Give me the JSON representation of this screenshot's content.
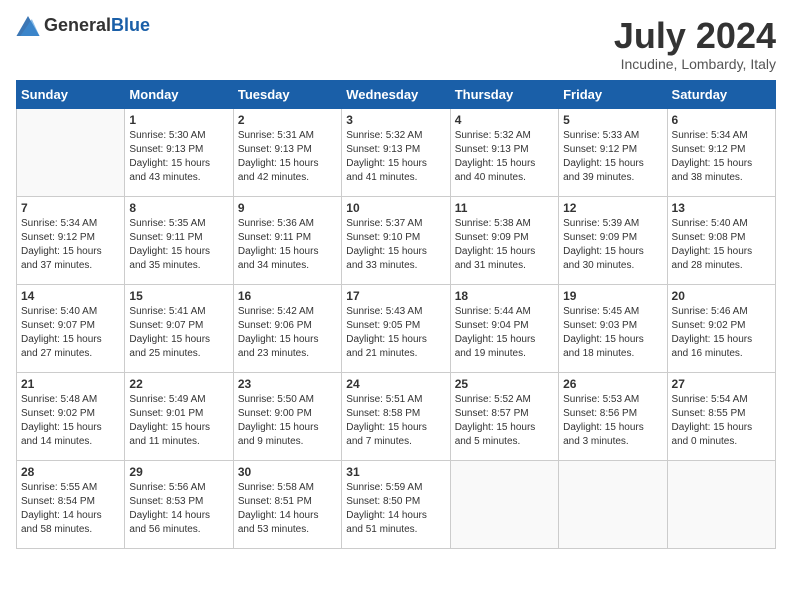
{
  "header": {
    "logo_general": "General",
    "logo_blue": "Blue",
    "title": "July 2024",
    "location": "Incudine, Lombardy, Italy"
  },
  "days_of_week": [
    "Sunday",
    "Monday",
    "Tuesday",
    "Wednesday",
    "Thursday",
    "Friday",
    "Saturday"
  ],
  "weeks": [
    [
      {
        "day": "",
        "sunrise": "",
        "sunset": "",
        "daylight": ""
      },
      {
        "day": "1",
        "sunrise": "Sunrise: 5:30 AM",
        "sunset": "Sunset: 9:13 PM",
        "daylight": "Daylight: 15 hours and 43 minutes."
      },
      {
        "day": "2",
        "sunrise": "Sunrise: 5:31 AM",
        "sunset": "Sunset: 9:13 PM",
        "daylight": "Daylight: 15 hours and 42 minutes."
      },
      {
        "day": "3",
        "sunrise": "Sunrise: 5:32 AM",
        "sunset": "Sunset: 9:13 PM",
        "daylight": "Daylight: 15 hours and 41 minutes."
      },
      {
        "day": "4",
        "sunrise": "Sunrise: 5:32 AM",
        "sunset": "Sunset: 9:13 PM",
        "daylight": "Daylight: 15 hours and 40 minutes."
      },
      {
        "day": "5",
        "sunrise": "Sunrise: 5:33 AM",
        "sunset": "Sunset: 9:12 PM",
        "daylight": "Daylight: 15 hours and 39 minutes."
      },
      {
        "day": "6",
        "sunrise": "Sunrise: 5:34 AM",
        "sunset": "Sunset: 9:12 PM",
        "daylight": "Daylight: 15 hours and 38 minutes."
      }
    ],
    [
      {
        "day": "7",
        "sunrise": "Sunrise: 5:34 AM",
        "sunset": "Sunset: 9:12 PM",
        "daylight": "Daylight: 15 hours and 37 minutes."
      },
      {
        "day": "8",
        "sunrise": "Sunrise: 5:35 AM",
        "sunset": "Sunset: 9:11 PM",
        "daylight": "Daylight: 15 hours and 35 minutes."
      },
      {
        "day": "9",
        "sunrise": "Sunrise: 5:36 AM",
        "sunset": "Sunset: 9:11 PM",
        "daylight": "Daylight: 15 hours and 34 minutes."
      },
      {
        "day": "10",
        "sunrise": "Sunrise: 5:37 AM",
        "sunset": "Sunset: 9:10 PM",
        "daylight": "Daylight: 15 hours and 33 minutes."
      },
      {
        "day": "11",
        "sunrise": "Sunrise: 5:38 AM",
        "sunset": "Sunset: 9:09 PM",
        "daylight": "Daylight: 15 hours and 31 minutes."
      },
      {
        "day": "12",
        "sunrise": "Sunrise: 5:39 AM",
        "sunset": "Sunset: 9:09 PM",
        "daylight": "Daylight: 15 hours and 30 minutes."
      },
      {
        "day": "13",
        "sunrise": "Sunrise: 5:40 AM",
        "sunset": "Sunset: 9:08 PM",
        "daylight": "Daylight: 15 hours and 28 minutes."
      }
    ],
    [
      {
        "day": "14",
        "sunrise": "Sunrise: 5:40 AM",
        "sunset": "Sunset: 9:07 PM",
        "daylight": "Daylight: 15 hours and 27 minutes."
      },
      {
        "day": "15",
        "sunrise": "Sunrise: 5:41 AM",
        "sunset": "Sunset: 9:07 PM",
        "daylight": "Daylight: 15 hours and 25 minutes."
      },
      {
        "day": "16",
        "sunrise": "Sunrise: 5:42 AM",
        "sunset": "Sunset: 9:06 PM",
        "daylight": "Daylight: 15 hours and 23 minutes."
      },
      {
        "day": "17",
        "sunrise": "Sunrise: 5:43 AM",
        "sunset": "Sunset: 9:05 PM",
        "daylight": "Daylight: 15 hours and 21 minutes."
      },
      {
        "day": "18",
        "sunrise": "Sunrise: 5:44 AM",
        "sunset": "Sunset: 9:04 PM",
        "daylight": "Daylight: 15 hours and 19 minutes."
      },
      {
        "day": "19",
        "sunrise": "Sunrise: 5:45 AM",
        "sunset": "Sunset: 9:03 PM",
        "daylight": "Daylight: 15 hours and 18 minutes."
      },
      {
        "day": "20",
        "sunrise": "Sunrise: 5:46 AM",
        "sunset": "Sunset: 9:02 PM",
        "daylight": "Daylight: 15 hours and 16 minutes."
      }
    ],
    [
      {
        "day": "21",
        "sunrise": "Sunrise: 5:48 AM",
        "sunset": "Sunset: 9:02 PM",
        "daylight": "Daylight: 15 hours and 14 minutes."
      },
      {
        "day": "22",
        "sunrise": "Sunrise: 5:49 AM",
        "sunset": "Sunset: 9:01 PM",
        "daylight": "Daylight: 15 hours and 11 minutes."
      },
      {
        "day": "23",
        "sunrise": "Sunrise: 5:50 AM",
        "sunset": "Sunset: 9:00 PM",
        "daylight": "Daylight: 15 hours and 9 minutes."
      },
      {
        "day": "24",
        "sunrise": "Sunrise: 5:51 AM",
        "sunset": "Sunset: 8:58 PM",
        "daylight": "Daylight: 15 hours and 7 minutes."
      },
      {
        "day": "25",
        "sunrise": "Sunrise: 5:52 AM",
        "sunset": "Sunset: 8:57 PM",
        "daylight": "Daylight: 15 hours and 5 minutes."
      },
      {
        "day": "26",
        "sunrise": "Sunrise: 5:53 AM",
        "sunset": "Sunset: 8:56 PM",
        "daylight": "Daylight: 15 hours and 3 minutes."
      },
      {
        "day": "27",
        "sunrise": "Sunrise: 5:54 AM",
        "sunset": "Sunset: 8:55 PM",
        "daylight": "Daylight: 15 hours and 0 minutes."
      }
    ],
    [
      {
        "day": "28",
        "sunrise": "Sunrise: 5:55 AM",
        "sunset": "Sunset: 8:54 PM",
        "daylight": "Daylight: 14 hours and 58 minutes."
      },
      {
        "day": "29",
        "sunrise": "Sunrise: 5:56 AM",
        "sunset": "Sunset: 8:53 PM",
        "daylight": "Daylight: 14 hours and 56 minutes."
      },
      {
        "day": "30",
        "sunrise": "Sunrise: 5:58 AM",
        "sunset": "Sunset: 8:51 PM",
        "daylight": "Daylight: 14 hours and 53 minutes."
      },
      {
        "day": "31",
        "sunrise": "Sunrise: 5:59 AM",
        "sunset": "Sunset: 8:50 PM",
        "daylight": "Daylight: 14 hours and 51 minutes."
      },
      {
        "day": "",
        "sunrise": "",
        "sunset": "",
        "daylight": ""
      },
      {
        "day": "",
        "sunrise": "",
        "sunset": "",
        "daylight": ""
      },
      {
        "day": "",
        "sunrise": "",
        "sunset": "",
        "daylight": ""
      }
    ]
  ]
}
